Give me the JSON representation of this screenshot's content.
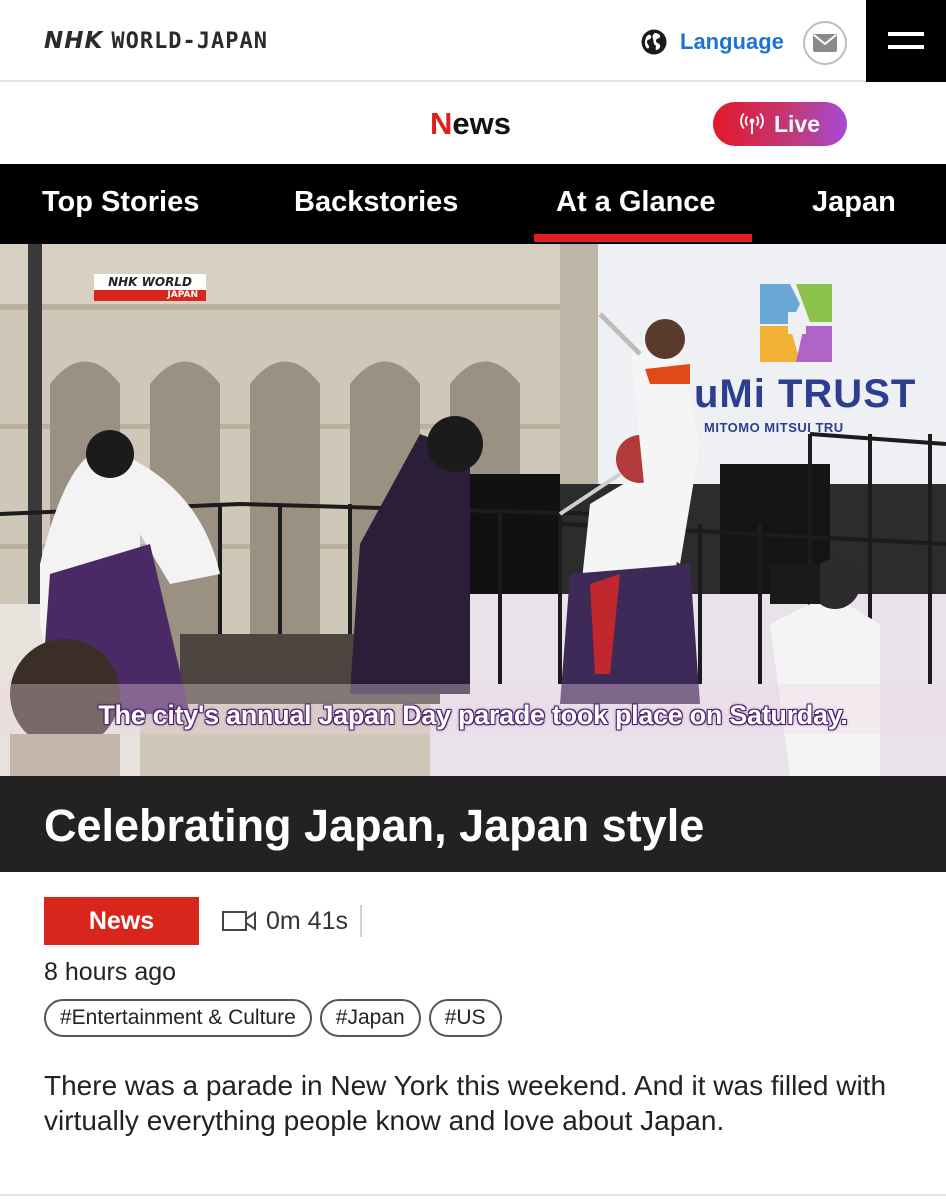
{
  "header": {
    "brand_nhk": "NHK",
    "brand_rest": "WORLD-JAPAN",
    "language_label": "Language",
    "icons": {
      "language": "globe-icon",
      "mail": "mail-icon",
      "menu": "hamburger-menu-icon"
    }
  },
  "section": {
    "title_first": "N",
    "title_rest": "ews",
    "live_label": "Live",
    "live_icon": "broadcast-icon"
  },
  "nav": {
    "items": [
      {
        "label": "Top Stories",
        "active": false
      },
      {
        "label": "Backstories",
        "active": false
      },
      {
        "label": "At a Glance",
        "active": true
      },
      {
        "label": "Japan",
        "active": false
      }
    ],
    "active_color": "#e01e1e"
  },
  "video": {
    "bug_top": "NHK WORLD",
    "bug_bottom": "JAPAN",
    "caption": "The city's annual Japan Day parade took place on Saturday.",
    "sign_text": "uMi TRUST",
    "sign_sub": "MITOMO MITSUI TRU"
  },
  "article": {
    "title": "Celebrating Japan, Japan style",
    "category": "News",
    "duration": "0m 41s",
    "duration_icon": "video-camera-icon",
    "posted": "8 hours ago",
    "tags": [
      "#Entertainment & Culture",
      "#Japan",
      "#US"
    ],
    "summary": "There was a parade in New York this weekend. And it was filled with virtually everything people know and love about Japan."
  },
  "colors": {
    "accent_red": "#d9261c",
    "link_blue": "#1d72d6",
    "title_bar": "#222222"
  }
}
